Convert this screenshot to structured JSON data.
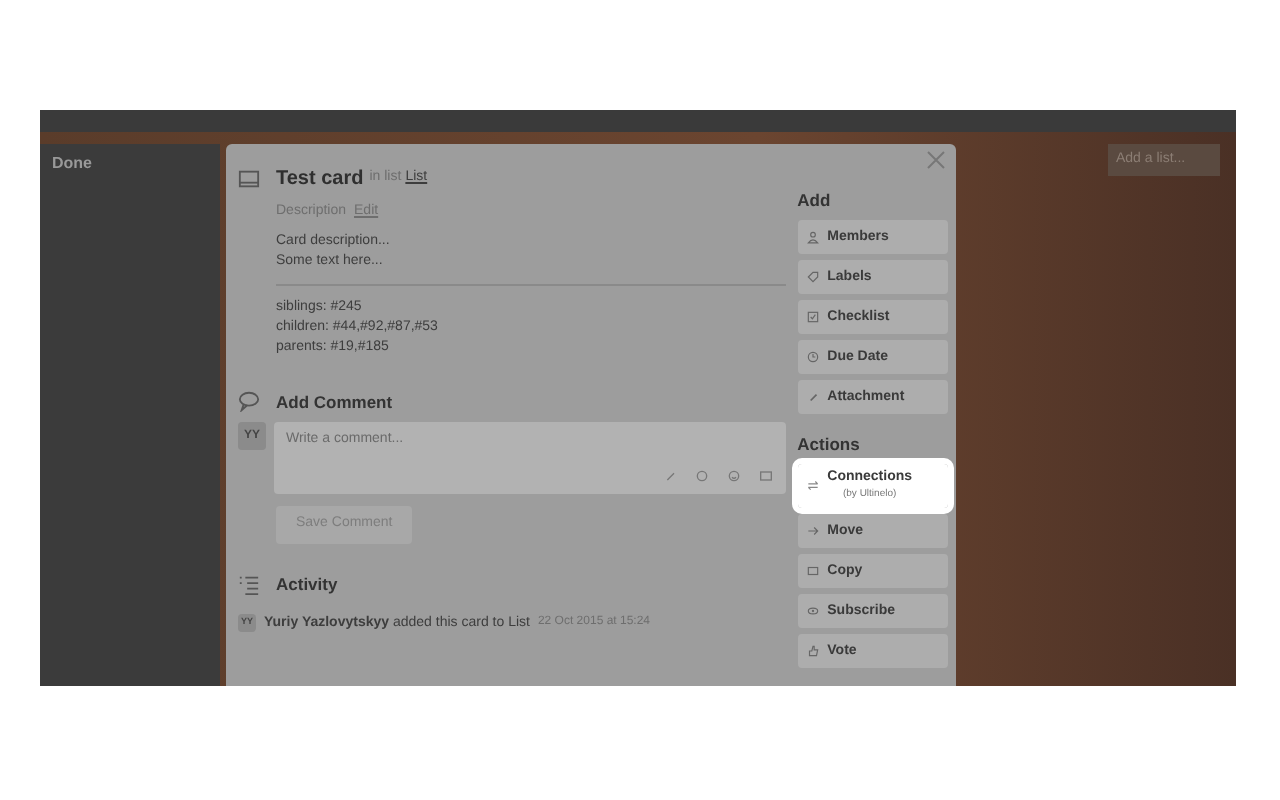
{
  "board": {
    "list_title": "Done",
    "add_list": "Add a list..."
  },
  "card": {
    "title": "Test card",
    "list_prefix": "in list",
    "list_name": "List",
    "description_label": "Description",
    "edit_link": "Edit",
    "description_lines": [
      "Card description...",
      "Some text here..."
    ],
    "connections": [
      "siblings: #245",
      "children: #44,#92,#87,#53",
      "parents: #19,#185"
    ]
  },
  "comment": {
    "heading": "Add Comment",
    "avatar": "YY",
    "placeholder": "Write a comment...",
    "save_button": "Save Comment"
  },
  "activity": {
    "heading": "Activity",
    "entries": [
      {
        "avatar": "YY",
        "author": "Yuriy Yazlovytskyy",
        "text": "added this card to List",
        "time": "22 Oct 2015 at 15:24"
      }
    ]
  },
  "sidebar": [
    {
      "heading": "Add",
      "buttons": [
        {
          "label": "Members",
          "highlighted": false
        },
        {
          "label": "Labels",
          "highlighted": false
        },
        {
          "label": "Checklist",
          "highlighted": false
        },
        {
          "label": "Due Date",
          "highlighted": false
        },
        {
          "label": "Attachment",
          "highlighted": false
        }
      ]
    },
    {
      "heading": "Actions",
      "buttons": [
        {
          "label": "Connections",
          "sublabel": "(by Ultinelo)",
          "highlighted": true
        },
        {
          "label": "Move",
          "highlighted": false
        },
        {
          "label": "Copy",
          "highlighted": false
        },
        {
          "label": "Subscribe",
          "highlighted": false
        },
        {
          "label": "Vote",
          "highlighted": false
        }
      ]
    }
  ]
}
